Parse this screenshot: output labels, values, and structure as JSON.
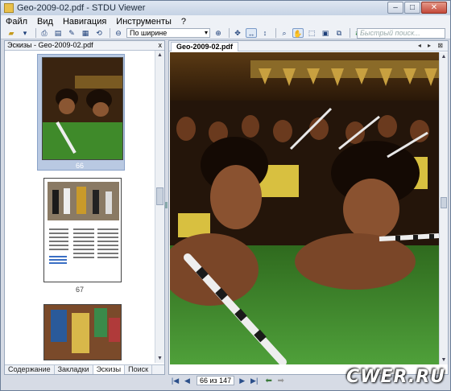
{
  "window": {
    "title": "Geo-2009-02.pdf - STDU Viewer"
  },
  "menu": [
    "Файл",
    "Вид",
    "Навигация",
    "Инструменты",
    "?"
  ],
  "toolbar": {
    "zoom_value": "По ширине",
    "search_placeholder": "Быстрый поиск..."
  },
  "left_pane": {
    "title": "Эскизы - Geo-2009-02.pdf",
    "close_glyph": "x",
    "thumbnails": [
      {
        "page": "66",
        "selected": true
      },
      {
        "page": "67",
        "selected": false
      },
      {
        "page": "",
        "selected": false
      }
    ],
    "tabs": [
      "Содержание",
      "Закладки",
      "Эскизы",
      "Поиск"
    ],
    "active_tab": "Эскизы"
  },
  "document": {
    "tab_label": "Geo-2009-02.pdf",
    "tab_controls": "◂ ▸ ⊠"
  },
  "navigation": {
    "page_indicator": "66 из 147"
  },
  "watermark": "CWER.RU",
  "colors": {
    "accent": "#3a6fc4",
    "selection": "#b9c9e2",
    "chrome": "#d6dbe5"
  }
}
